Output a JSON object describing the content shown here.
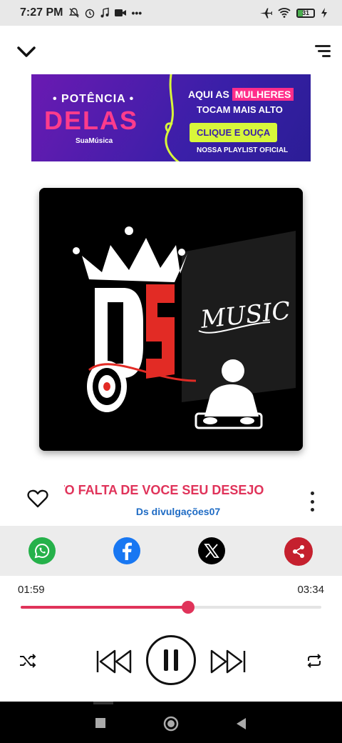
{
  "status_bar": {
    "time": "7:27 PM",
    "battery": "31",
    "icons": [
      "muted-notifications-icon",
      "alarm-icon",
      "music-note-icon",
      "video-icon",
      "more-dots-icon",
      "airplane-icon",
      "wifi-icon",
      "battery-icon",
      "charging-icon"
    ]
  },
  "header": {
    "collapse_icon": "chevron-down-icon",
    "queue_icon": "sort-lines-icon"
  },
  "banner": {
    "potencia": "• POTÊNCIA •",
    "delas": "DELAS",
    "brand": "SuaMúsica",
    "line1_prefix": "AQUI AS",
    "line1_highlight": "MULHERES",
    "line2": "TOCAM MAIS ALTO",
    "cta": "CLIQUE E OUÇA",
    "line3": "NOSSA PLAYLIST OFICIAL"
  },
  "album": {
    "logo_letters": "DS",
    "music_text": "MUSIC"
  },
  "track": {
    "title": "TO FALTA DE VOCE SEU DESEJO",
    "artist": "Ds divulgações07"
  },
  "share": {
    "items": [
      {
        "name": "whatsapp",
        "color": "#25b14a"
      },
      {
        "name": "facebook",
        "color": "#1877f2"
      },
      {
        "name": "x",
        "color": "#000000"
      },
      {
        "name": "share",
        "color": "#c5202e"
      }
    ]
  },
  "player": {
    "elapsed": "01:59",
    "duration": "03:34",
    "progress_fraction": 0.556,
    "accent": "#e0335a",
    "controls": [
      "shuffle-icon",
      "previous-icon",
      "pause-icon",
      "next-icon",
      "repeat-icon"
    ]
  }
}
